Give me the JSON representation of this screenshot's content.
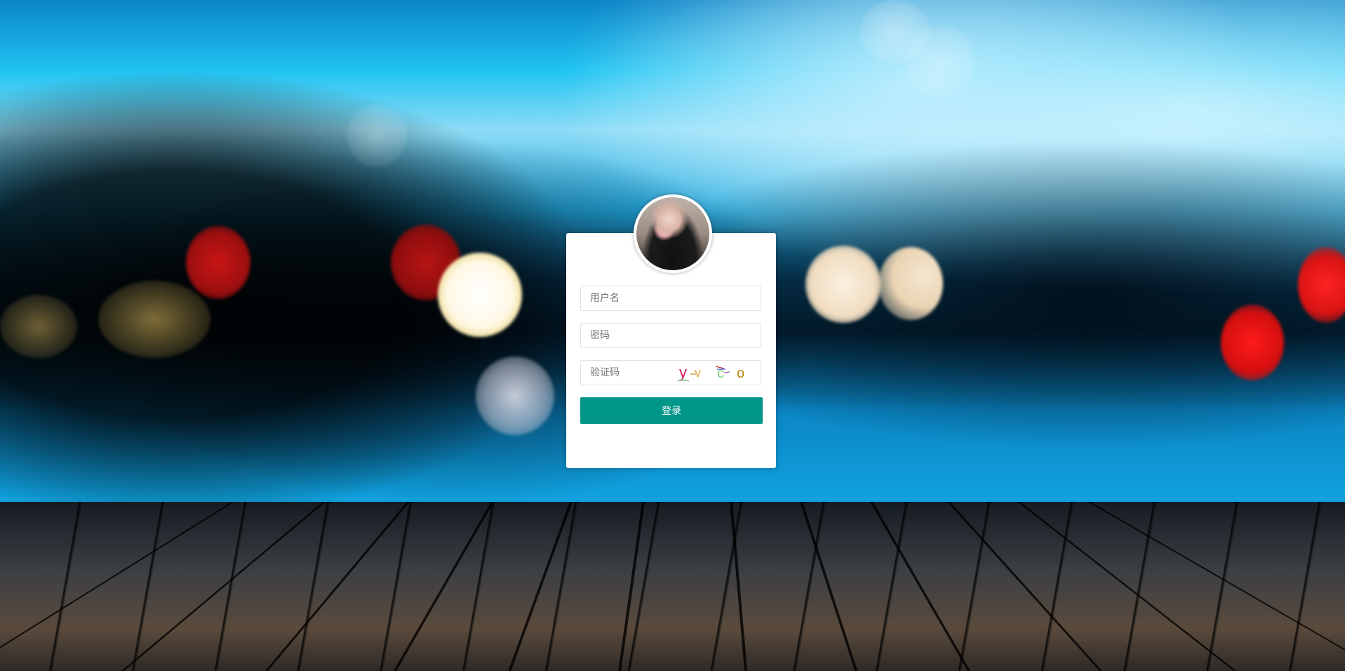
{
  "login": {
    "username_placeholder": "用户名",
    "password_placeholder": "密码",
    "captcha_placeholder": "验证码",
    "captcha_text": "yvco",
    "submit_label": "登录"
  },
  "colors": {
    "primary_button": "#009688",
    "card_background": "#ffffff"
  }
}
